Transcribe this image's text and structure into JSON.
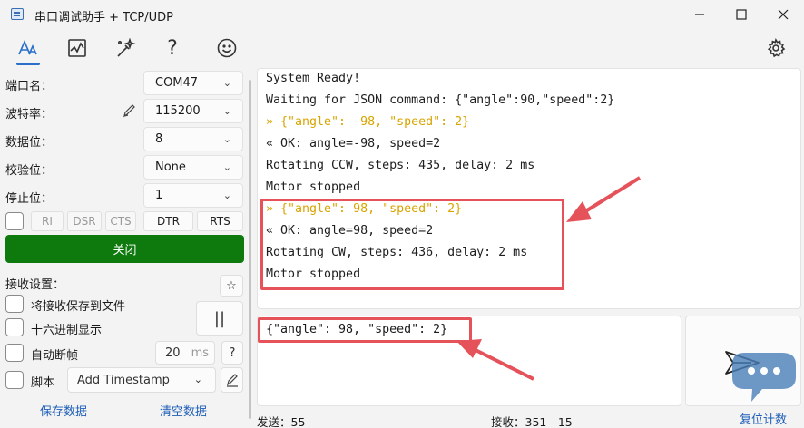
{
  "window": {
    "title": "串口调试助手 + TCP/UDP",
    "minimize": "—",
    "maximize": "☐",
    "close": "✕"
  },
  "toolbar": {
    "icons": [
      "font-icon",
      "chart-icon",
      "magic-icon",
      "help-icon",
      "emoji-icon",
      "gear-icon"
    ],
    "help": "?",
    "accent": "#2a6fc9"
  },
  "settings": {
    "port_label": "端口名：",
    "port_value": "COM47",
    "baud_label": "波特率：",
    "baud_value": "115200",
    "databits_label": "数据位：",
    "databits_value": "8",
    "parity_label": "校验位：",
    "parity_value": "None",
    "stopbits_label": "停止位：",
    "stopbits_value": "1"
  },
  "signals": {
    "ri": "RI",
    "dsr": "DSR",
    "cts": "CTS",
    "dtr": "DTR",
    "rts": "RTS"
  },
  "close_button": {
    "label": "关闭",
    "color": "#0e7a0e"
  },
  "receive_settings": {
    "header": "接收设置：",
    "save_to_file": "将接收保存到文件",
    "hex_display": "十六进制显示",
    "auto_frame": "自动断帧",
    "frame_ms_value": "20",
    "frame_ms_unit": "ms",
    "frame_help": "?",
    "script_label": "脚本",
    "script_value": "Add Timestamp",
    "pause": "||",
    "star": "☆"
  },
  "actions": {
    "save_data": "保存数据",
    "clear_data": "清空数据",
    "reset_count": "复位计数"
  },
  "receive_log": [
    {
      "text": "System Ready!",
      "kind": "rx"
    },
    {
      "text": "Waiting for JSON command: {\"angle\":90,\"speed\":2}",
      "kind": "rx"
    },
    {
      "text": "» {\"angle\": -98, \"speed\": 2}",
      "kind": "tx"
    },
    {
      "text": "« OK: angle=-98, speed=2",
      "kind": "rx"
    },
    {
      "text": "Rotating CCW, steps: 435, delay: 2 ms",
      "kind": "rx"
    },
    {
      "text": "Motor stopped",
      "kind": "rx"
    },
    {
      "text": "» {\"angle\": 98, \"speed\": 2}",
      "kind": "tx"
    },
    {
      "text": "« OK: angle=98, speed=2",
      "kind": "rx"
    },
    {
      "text": "Rotating CW, steps: 436, delay: 2 ms",
      "kind": "rx"
    },
    {
      "text": "Motor stopped",
      "kind": "rx"
    }
  ],
  "send_input": {
    "value": "{\"angle\": 98, \"speed\": 2}"
  },
  "status": {
    "sent": "发送：55",
    "received": "接收：351 - 15"
  },
  "colors": {
    "tx_text": "#d9a400",
    "highlight": "#e5525a",
    "link": "#1f5fb8"
  }
}
